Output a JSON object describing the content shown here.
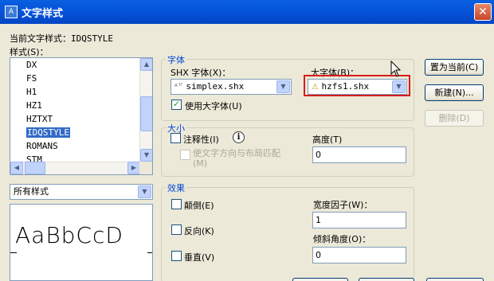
{
  "window": {
    "title": "文字样式",
    "close_glyph": "✕"
  },
  "current_style": {
    "label": "当前文字样式：",
    "value": "IDQSTYLE"
  },
  "styles": {
    "label": "样式(S)：",
    "items": [
      "DX",
      "FS",
      "H1",
      "HZ1",
      "HZTXT",
      "IDQSTYLE",
      "ROMANS",
      "STM"
    ],
    "selected": "IDQSTYLE"
  },
  "filter": {
    "value": "所有样式"
  },
  "preview": {
    "text": "AaBbCcD"
  },
  "font": {
    "group_title": "字体",
    "shx_label": "SHX 字体(X)：",
    "shx_value": "simplex.shx",
    "bigfont_label": "大字体(B)：",
    "bigfont_value": "hzfs1.shx",
    "use_bigfont_label": "使用大字体(U)",
    "use_bigfont_checked": true
  },
  "size": {
    "group_title": "大小",
    "annotative_label": "注释性(I)",
    "annotative_checked": false,
    "match_layout_label": "使文字方向与布局匹配(M)",
    "height_label": "高度(T)",
    "height_value": "0"
  },
  "effects": {
    "group_title": "效果",
    "upside_down_label": "颠倒(E)",
    "backwards_label": "反向(K)",
    "vertical_label": "垂直(V)",
    "width_factor_label": "宽度因子(W)：",
    "width_factor_value": "1",
    "oblique_label": "倾斜角度(O)：",
    "oblique_value": "0"
  },
  "buttons": {
    "set_current": "置为当前(C)",
    "new": "新建(N)...",
    "delete": "删除(D)"
  },
  "icons": {
    "app": "app-icon",
    "font_type": "truetype-font-icon",
    "bigfont_type": "warning-font-icon",
    "info": "info-icon"
  }
}
